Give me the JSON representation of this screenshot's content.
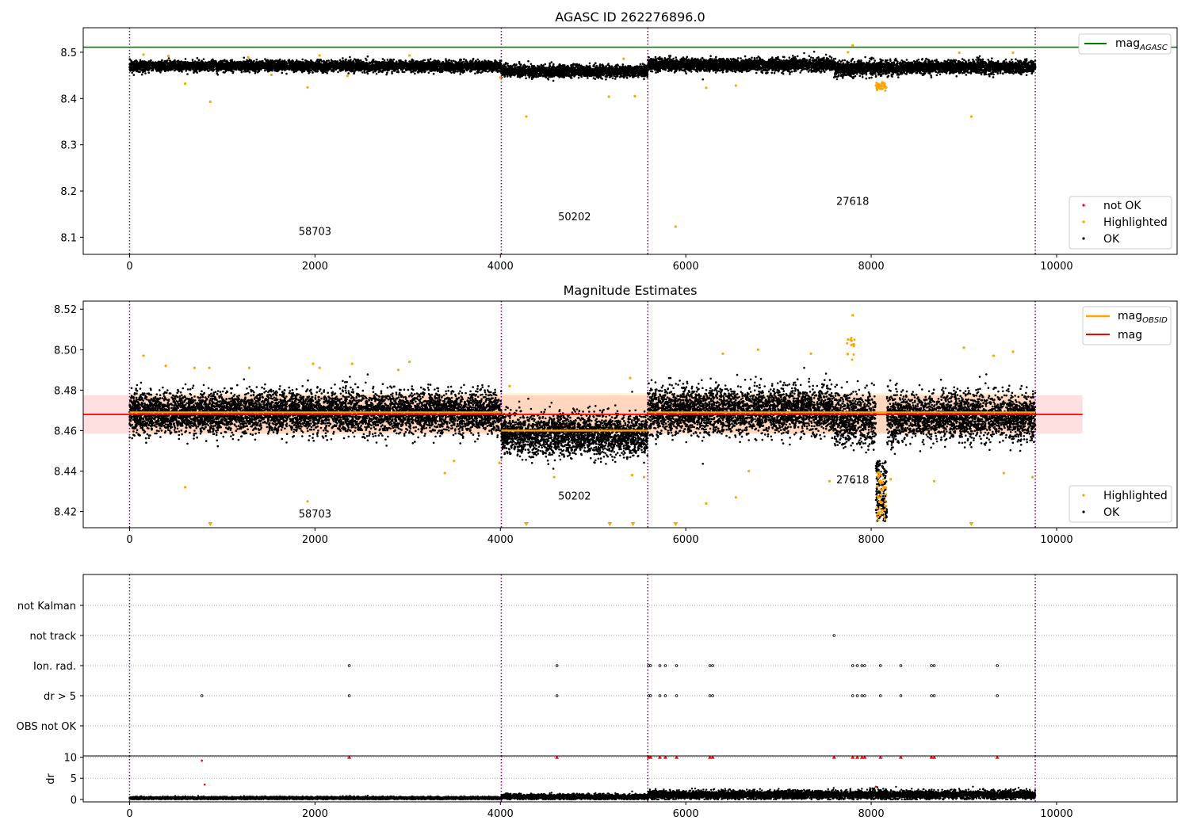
{
  "chart_data": [
    {
      "type": "scatter",
      "title": "AGASC ID 262276896.0",
      "xlim": [
        -500,
        11300
      ],
      "ylim": [
        8.063,
        8.553
      ],
      "x_ticks": [
        0,
        2000,
        4000,
        6000,
        8000,
        10000
      ],
      "y_ticks": [
        8.1,
        8.2,
        8.3,
        8.4,
        8.5
      ],
      "y_tick_labels": [
        "8.1",
        "8.2",
        "8.3",
        "8.4",
        "8.5"
      ],
      "obs_boundaries": [
        0,
        4010,
        5590,
        9770
      ],
      "obsid_labels": [
        {
          "text": "58703",
          "x": 2000,
          "y": 8.105
        },
        {
          "text": "50202",
          "x": 4800,
          "y": 8.137
        },
        {
          "text": "27618",
          "x": 7800,
          "y": 8.17
        }
      ],
      "lines": [
        {
          "name": "mag$_{AGASC}$",
          "label_main": "mag",
          "label_sub": "AGASC",
          "y": 8.511,
          "x_range": [
            -500,
            11300
          ],
          "color": "#008000"
        }
      ],
      "series": [
        {
          "name": "not OK",
          "color": "#ff0000",
          "points": []
        },
        {
          "name": "Highlighted",
          "color": "#ffa500",
          "points": [
            [
              150,
              8.495
            ],
            [
              420,
              8.492
            ],
            [
              600,
              8.432
            ],
            [
              870,
              8.393
            ],
            [
              1280,
              8.489
            ],
            [
              1530,
              8.451
            ],
            [
              1920,
              8.424
            ],
            [
              2050,
              8.493
            ],
            [
              2350,
              8.449
            ],
            [
              3020,
              8.493
            ],
            [
              4000,
              8.445
            ],
            [
              4280,
              8.361
            ],
            [
              5170,
              8.404
            ],
            [
              5330,
              8.486
            ],
            [
              5450,
              8.405
            ],
            [
              5890,
              8.123
            ],
            [
              6220,
              8.423
            ],
            [
              6540,
              8.428
            ],
            [
              7750,
              8.5
            ],
            [
              7800,
              8.515
            ],
            [
              8080,
              8.425
            ],
            [
              8120,
              8.435
            ],
            [
              8950,
              8.499
            ],
            [
              9080,
              8.361
            ],
            [
              9530,
              8.499
            ]
          ]
        },
        {
          "name": "OK",
          "color": "#000000",
          "band": [
            {
              "x0": 0,
              "x1": 4010,
              "center": 8.47,
              "spread": 0.01
            },
            {
              "x0": 4010,
              "x1": 5590,
              "center": 8.459,
              "spread": 0.011
            },
            {
              "x0": 5590,
              "x1": 7600,
              "center": 8.473,
              "spread": 0.012
            },
            {
              "x0": 7600,
              "x1": 8300,
              "center": 8.465,
              "spread": 0.014
            },
            {
              "x0": 8300,
              "x1": 9770,
              "center": 8.468,
              "spread": 0.012
            }
          ]
        }
      ],
      "legends": [
        {
          "position": "upper-right",
          "entries": [
            "mag$_{AGASC}$"
          ]
        },
        {
          "position": "lower-right",
          "entries": [
            "not OK",
            "Highlighted",
            "OK"
          ]
        }
      ]
    },
    {
      "type": "scatter",
      "title": "Magnitude Estimates",
      "xlim": [
        -500,
        11300
      ],
      "ylim": [
        8.412,
        8.524
      ],
      "x_ticks": [
        0,
        2000,
        4000,
        6000,
        8000,
        10000
      ],
      "y_ticks": [
        8.42,
        8.44,
        8.46,
        8.48,
        8.5,
        8.52
      ],
      "y_tick_labels": [
        "8.42",
        "8.44",
        "8.46",
        "8.48",
        "8.50",
        "8.52"
      ],
      "obs_boundaries": [
        0,
        4010,
        5590,
        9770
      ],
      "obsid_labels": [
        {
          "text": "58703",
          "x": 2000,
          "y": 8.417
        },
        {
          "text": "50202",
          "x": 4800,
          "y": 8.426
        },
        {
          "text": "27618",
          "x": 7800,
          "y": 8.434
        }
      ],
      "mag": {
        "value": 8.468,
        "band": [
          8.4585,
          8.4775
        ],
        "x_range": [
          -500,
          10280
        ],
        "color": "#ff0000"
      },
      "mag_obsid": [
        {
          "x0": 0,
          "x1": 4010,
          "value": 8.469
        },
        {
          "x0": 4010,
          "x1": 5590,
          "value": 8.46
        },
        {
          "x0": 5590,
          "x1": 9770,
          "value": 8.469
        }
      ],
      "mag_obsid_color": "#ffa500",
      "series": [
        {
          "name": "Highlighted",
          "color": "#ffa500",
          "points": [
            [
              150,
              8.497
            ],
            [
              390,
              8.492
            ],
            [
              600,
              8.432
            ],
            [
              700,
              8.491
            ],
            [
              860,
              8.491
            ],
            [
              1290,
              8.491
            ],
            [
              1920,
              8.425
            ],
            [
              1980,
              8.493
            ],
            [
              2050,
              8.491
            ],
            [
              2400,
              8.493
            ],
            [
              2900,
              8.49
            ],
            [
              3020,
              8.494
            ],
            [
              3400,
              8.439
            ],
            [
              3500,
              8.445
            ],
            [
              3990,
              8.444
            ],
            [
              4100,
              8.482
            ],
            [
              4580,
              8.437
            ],
            [
              5400,
              8.486
            ],
            [
              5420,
              8.438
            ],
            [
              5550,
              8.437
            ],
            [
              6220,
              8.424
            ],
            [
              6400,
              8.498
            ],
            [
              6540,
              8.427
            ],
            [
              6680,
              8.44
            ],
            [
              6780,
              8.5
            ],
            [
              7350,
              8.498
            ],
            [
              7550,
              8.435
            ],
            [
              7750,
              8.505
            ],
            [
              7800,
              8.517
            ],
            [
              8210,
              8.436
            ],
            [
              8680,
              8.435
            ],
            [
              9000,
              8.501
            ],
            [
              9320,
              8.497
            ],
            [
              9430,
              8.439
            ],
            [
              9530,
              8.499
            ],
            [
              9740,
              8.437
            ]
          ]
        },
        {
          "name": "OK",
          "color": "#000000",
          "band": [
            {
              "x0": 0,
              "x1": 4010,
              "center": 8.469,
              "spread": 0.009
            },
            {
              "x0": 4010,
              "x1": 5590,
              "center": 8.458,
              "spread": 0.009
            },
            {
              "x0": 5590,
              "x1": 7600,
              "center": 8.47,
              "spread": 0.01
            },
            {
              "x0": 7600,
              "x1": 8300,
              "center": 8.466,
              "spread": 0.012
            },
            {
              "x0": 8300,
              "x1": 9770,
              "center": 8.467,
              "spread": 0.01
            }
          ]
        }
      ],
      "out_of_range_markers": [
        870,
        4280,
        5180,
        5430,
        5890,
        9080
      ],
      "legends": [
        {
          "position": "upper-right",
          "entries": [
            "mag$_{OBSID}$",
            "mag"
          ]
        },
        {
          "position": "lower-right",
          "entries": [
            "Highlighted",
            "OK"
          ]
        }
      ]
    },
    {
      "type": "scatter",
      "title": "",
      "xlim": [
        -500,
        11300
      ],
      "categories": [
        "not Kalman",
        "not track",
        "Ion. rad.",
        "dr > 5",
        "OBS not OK"
      ],
      "obs_boundaries": [
        0,
        4010,
        5590,
        9770
      ],
      "flags": {
        "not Kalman": [],
        "not track": [
          7600
        ],
        "Ion. rad.": [
          2370,
          4610,
          5600,
          5620,
          5720,
          5780,
          5900,
          6260,
          6290,
          7800,
          7850,
          7900,
          7930,
          8100,
          8320,
          8650,
          8680,
          9360
        ],
        "dr > 5": [
          780,
          2370,
          4610,
          5600,
          5620,
          5720,
          5780,
          5900,
          6260,
          6290,
          7800,
          7850,
          7900,
          7930,
          8100,
          8320,
          8650,
          8680,
          9360
        ],
        "OBS not OK": []
      }
    },
    {
      "type": "scatter",
      "ylabel": "dr",
      "xlim": [
        -500,
        11300
      ],
      "ylim": [
        -0.6,
        10.3
      ],
      "x_ticks": [
        0,
        2000,
        4000,
        6000,
        8000,
        10000
      ],
      "y_ticks": [
        0,
        5,
        10
      ],
      "y_tick_labels": [
        "0",
        "5",
        "10"
      ],
      "obs_boundaries": [
        0,
        4010,
        5590,
        9770
      ],
      "clipped_markers": [
        2370,
        4610,
        5600,
        5620,
        5720,
        5780,
        5900,
        6260,
        6290,
        7600,
        7800,
        7850,
        7900,
        7930,
        8100,
        8320,
        8650,
        8680,
        9360
      ],
      "red_points": [
        [
          780,
          9.2
        ],
        [
          810,
          3.5
        ],
        [
          8050,
          3.0
        ]
      ],
      "black_band": [
        {
          "x0": 0,
          "x1": 4010,
          "center": 0.3,
          "spread": 0.15
        },
        {
          "x0": 4010,
          "x1": 5590,
          "center": 0.6,
          "spread": 0.3
        },
        {
          "x0": 5590,
          "x1": 9770,
          "center": 1.1,
          "spread": 0.5
        }
      ]
    }
  ],
  "colors": {
    "boundary": "#800080",
    "grid": "#b0b0b0"
  }
}
